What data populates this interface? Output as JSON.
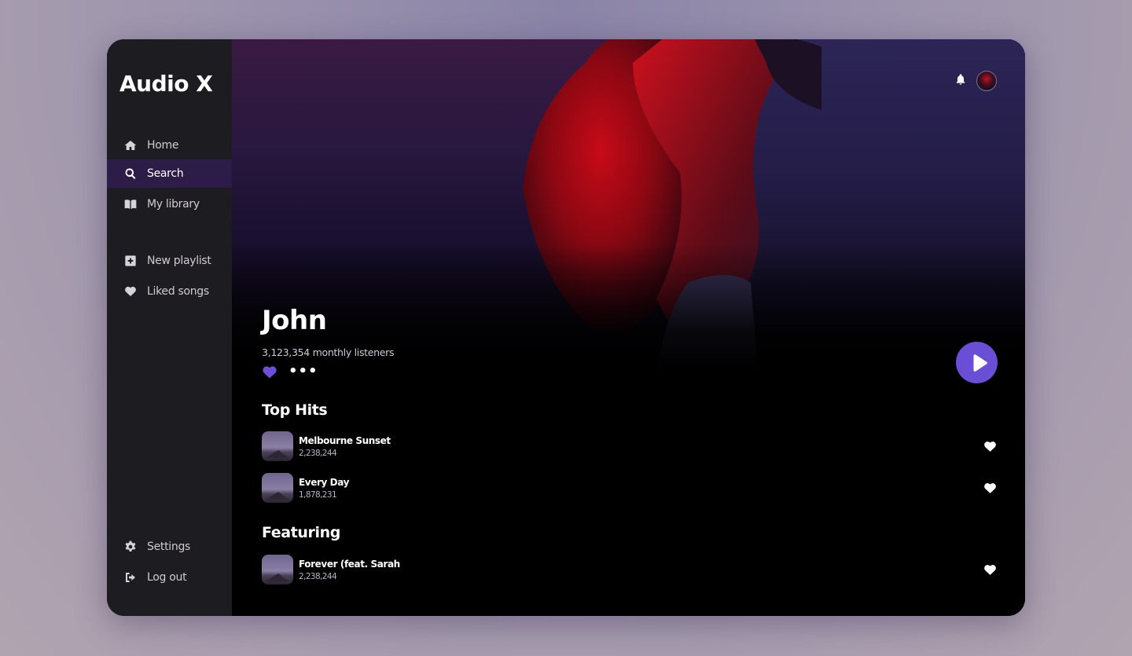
{
  "app": {
    "title": "Audio X"
  },
  "sidebar": {
    "nav": [
      {
        "label": "Home",
        "icon": "home-icon",
        "active": false
      },
      {
        "label": "Search",
        "icon": "search-icon",
        "active": true
      },
      {
        "label": "My library",
        "icon": "book-icon",
        "active": false
      }
    ],
    "playlist_actions": [
      {
        "label": "New playlist",
        "icon": "plus-square-icon"
      },
      {
        "label": "Liked songs",
        "icon": "heart-icon"
      }
    ],
    "footer": [
      {
        "label": "Settings",
        "icon": "gear-icon"
      },
      {
        "label": "Log out",
        "icon": "logout-icon"
      }
    ]
  },
  "header": {
    "notification_icon": "bell-icon",
    "avatar_icon": "user-avatar"
  },
  "artist": {
    "name": "John",
    "monthly_listeners": "3,123,354 monthly listeners",
    "liked": true,
    "more_label": "•••"
  },
  "sections": {
    "top_hits": {
      "title": "Top Hits",
      "tracks": [
        {
          "title": "Melbourne Sunset",
          "plays": "2,238,244"
        },
        {
          "title": "Every Day",
          "plays": "1,878,231"
        }
      ]
    },
    "featuring": {
      "title": "Featuring",
      "tracks": [
        {
          "title": "Forever (feat. Sarah",
          "plays": "2,238,244"
        }
      ]
    }
  },
  "colors": {
    "accent": "#6a4ed6",
    "sidebar_bg": "#1d1c20",
    "active_nav_bg": "#2c1d48",
    "main_bg": "#000000"
  }
}
